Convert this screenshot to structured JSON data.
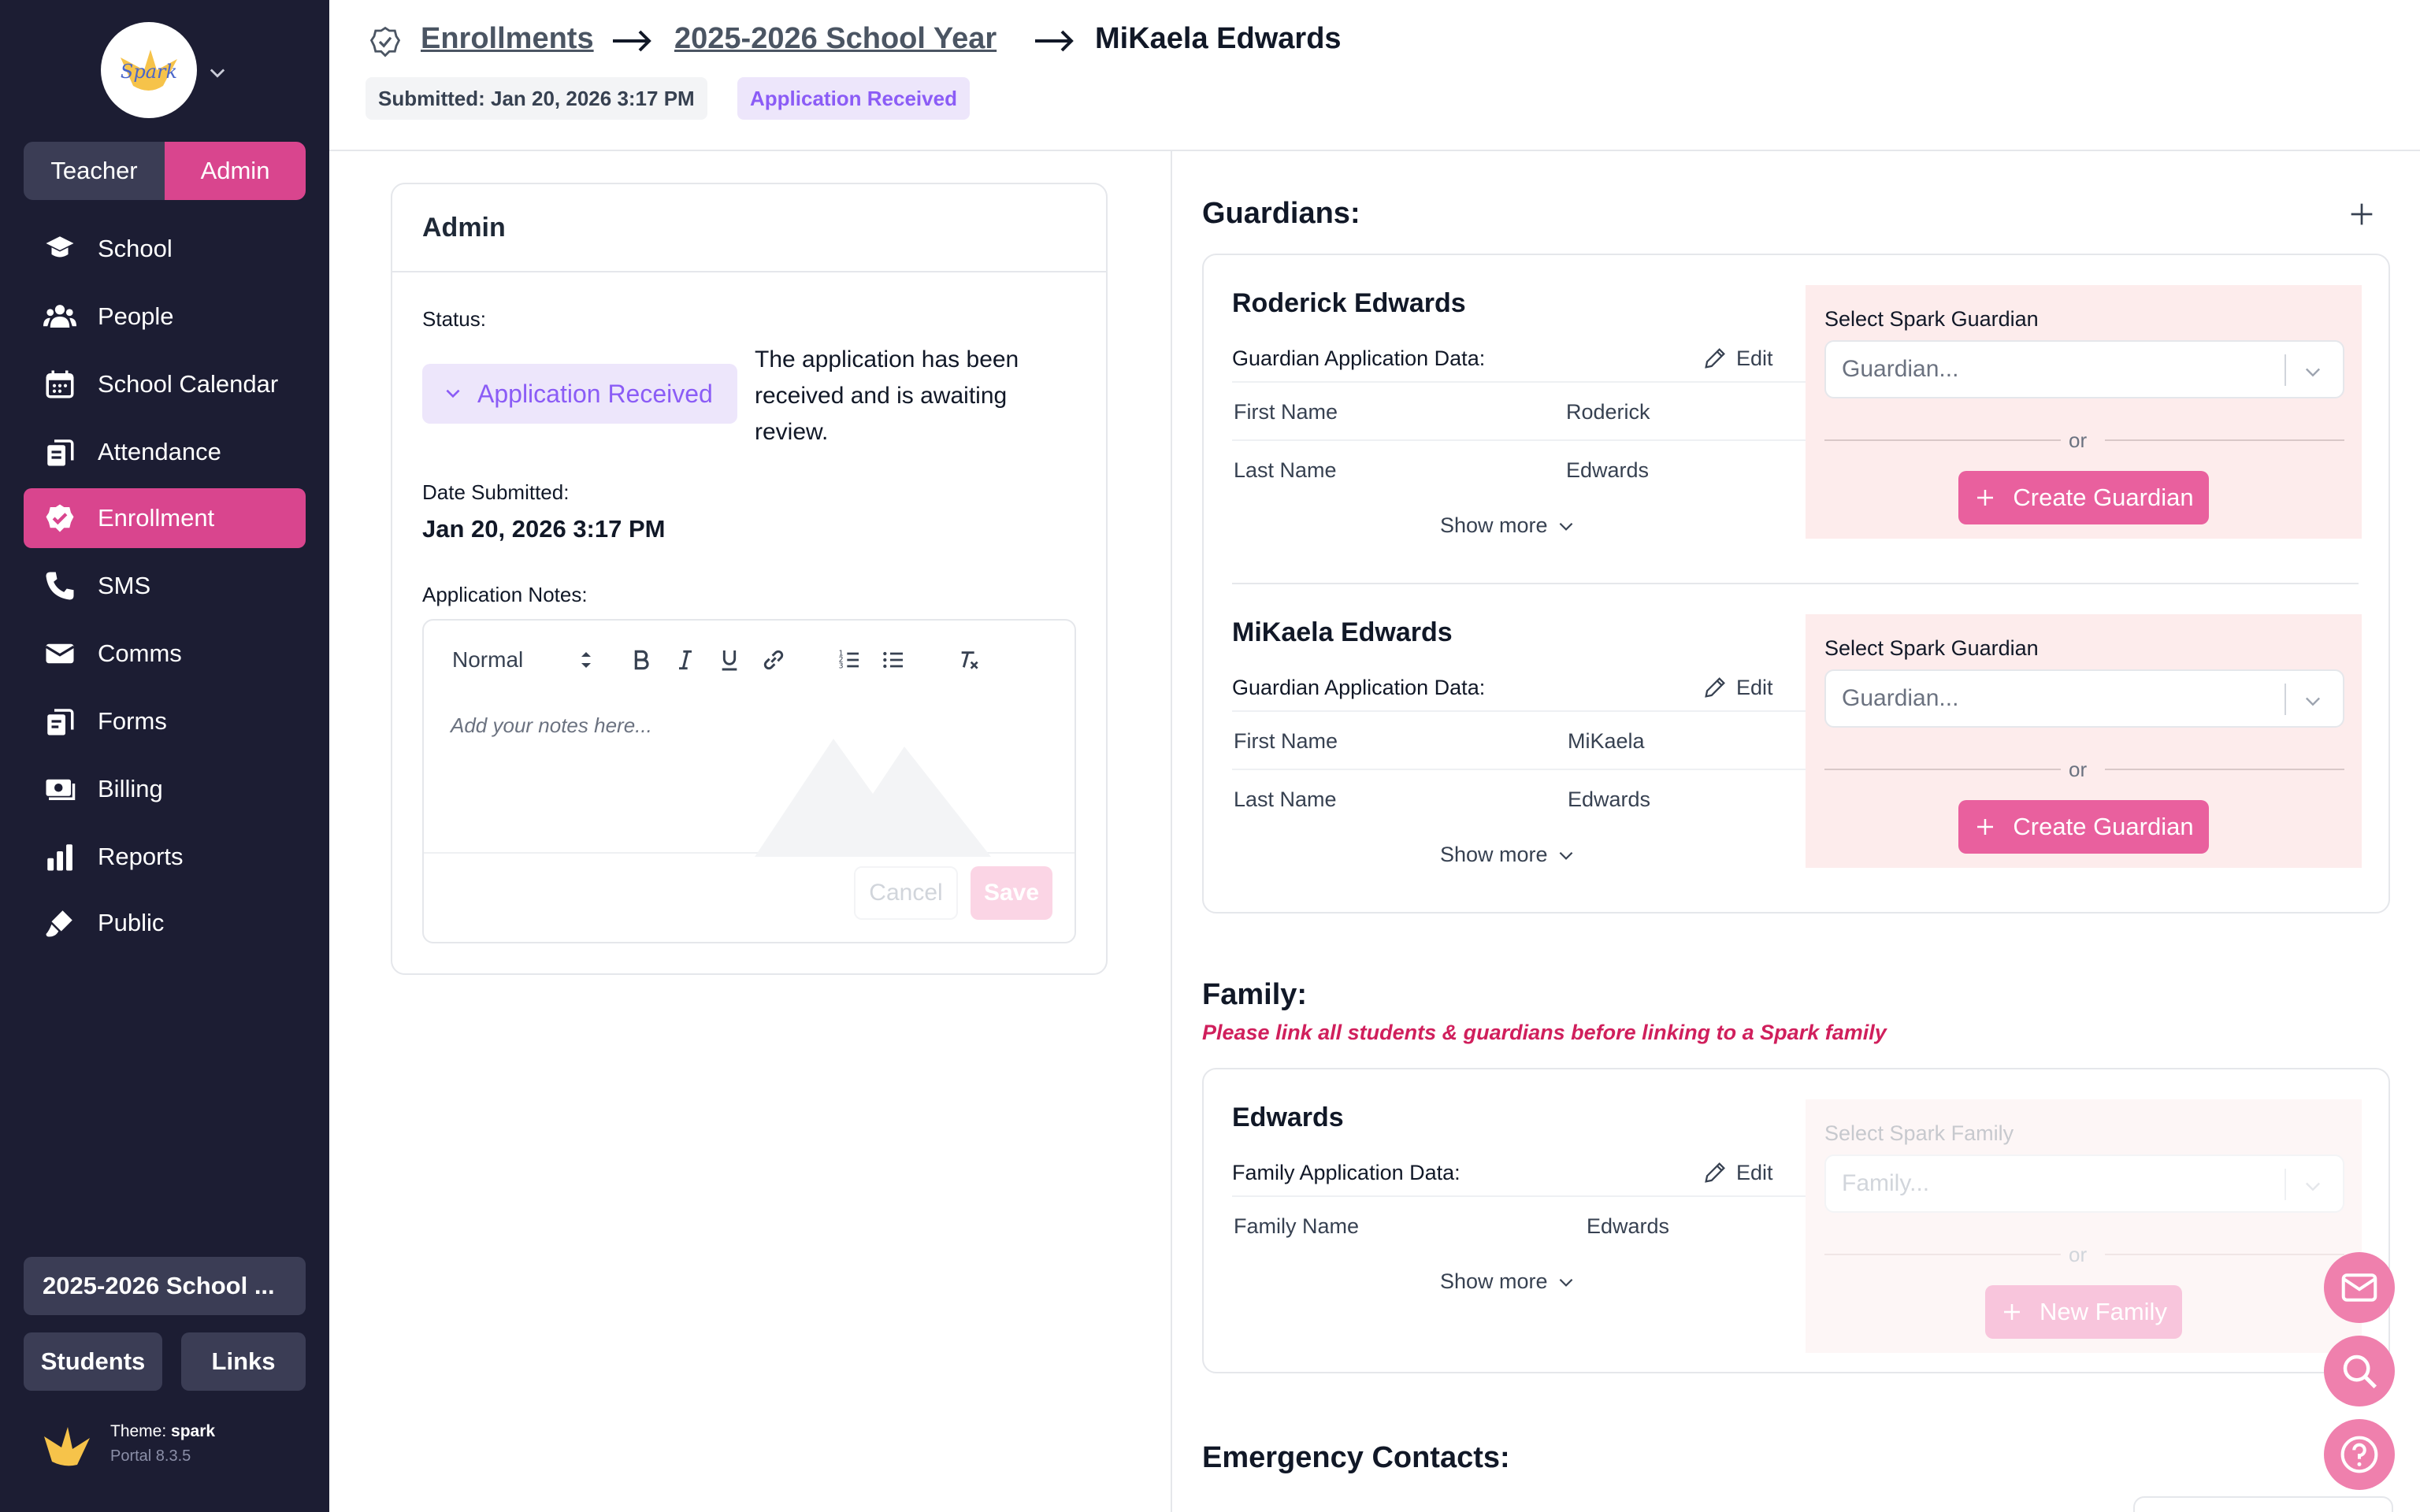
{
  "sidebar": {
    "role_toggle": {
      "teacher": "Teacher",
      "admin": "Admin"
    },
    "items": [
      {
        "label": "School",
        "icon": "school-icon"
      },
      {
        "label": "People",
        "icon": "people-icon"
      },
      {
        "label": "School Calendar",
        "icon": "calendar-icon"
      },
      {
        "label": "Attendance",
        "icon": "attendance-icon"
      },
      {
        "label": "Enrollment",
        "icon": "enrollment-icon",
        "active": true
      },
      {
        "label": "SMS",
        "icon": "phone-icon"
      },
      {
        "label": "Comms",
        "icon": "envelope-icon"
      },
      {
        "label": "Forms",
        "icon": "forms-icon"
      },
      {
        "label": "Billing",
        "icon": "billing-icon"
      },
      {
        "label": "Reports",
        "icon": "bar-chart-icon"
      },
      {
        "label": "Public",
        "icon": "brush-icon"
      }
    ],
    "school_year": "2025-2026 School ...",
    "students_label": "Students",
    "links_label": "Links",
    "theme_prefix": "Theme: ",
    "theme_name": "spark",
    "portal_version": "Portal 8.3.5"
  },
  "header": {
    "breadcrumb": [
      "Enrollments",
      "2025-2026 School Year"
    ],
    "current": "MiKaela Edwards",
    "submitted": "Submitted: Jan 20, 2026 3:17 PM",
    "status_chip": "Application Received"
  },
  "admin_card": {
    "title": "Admin",
    "status_label": "Status:",
    "status_value": "Application Received",
    "status_description": "The application has been received and is awaiting review.",
    "date_label": "Date Submitted:",
    "date_value": "Jan 20, 2026 3:17 PM",
    "notes_label": "Application Notes:",
    "editor": {
      "format": "Normal",
      "placeholder": "Add your notes here...",
      "cancel": "Cancel",
      "save": "Save"
    }
  },
  "guardians": {
    "title": "Guardians:",
    "list": [
      {
        "name": "Roderick Edwards",
        "data_label": "Guardian Application Data:",
        "edit": "Edit",
        "fields": [
          {
            "key": "First Name",
            "value": "Roderick"
          },
          {
            "key": "Last Name",
            "value": "Edwards"
          }
        ],
        "show_more": "Show more",
        "select_label": "Select Spark Guardian",
        "select_placeholder": "Guardian...",
        "or": "or",
        "create": "Create Guardian"
      },
      {
        "name": "MiKaela Edwards",
        "data_label": "Guardian Application Data:",
        "edit": "Edit",
        "fields": [
          {
            "key": "First Name",
            "value": "MiKaela"
          },
          {
            "key": "Last Name",
            "value": "Edwards"
          }
        ],
        "show_more": "Show more",
        "select_label": "Select Spark Guardian",
        "select_placeholder": "Guardian...",
        "or": "or",
        "create": "Create Guardian"
      }
    ]
  },
  "family": {
    "title": "Family:",
    "warning": "Please link all students & guardians before linking to a Spark family",
    "name": "Edwards",
    "data_label": "Family Application Data:",
    "edit": "Edit",
    "fields": [
      {
        "key": "Family Name",
        "value": "Edwards"
      }
    ],
    "show_more": "Show more",
    "select_label": "Select Spark Family",
    "select_placeholder": "Family...",
    "or": "or",
    "create": "New Family"
  },
  "emergency": {
    "title": "Emergency Contacts:"
  },
  "colors": {
    "sidebar_bg": "#1c1d33",
    "accent": "#d9458e",
    "status_purple": "#8b5cf6",
    "panel_pink": "#fdecec"
  }
}
